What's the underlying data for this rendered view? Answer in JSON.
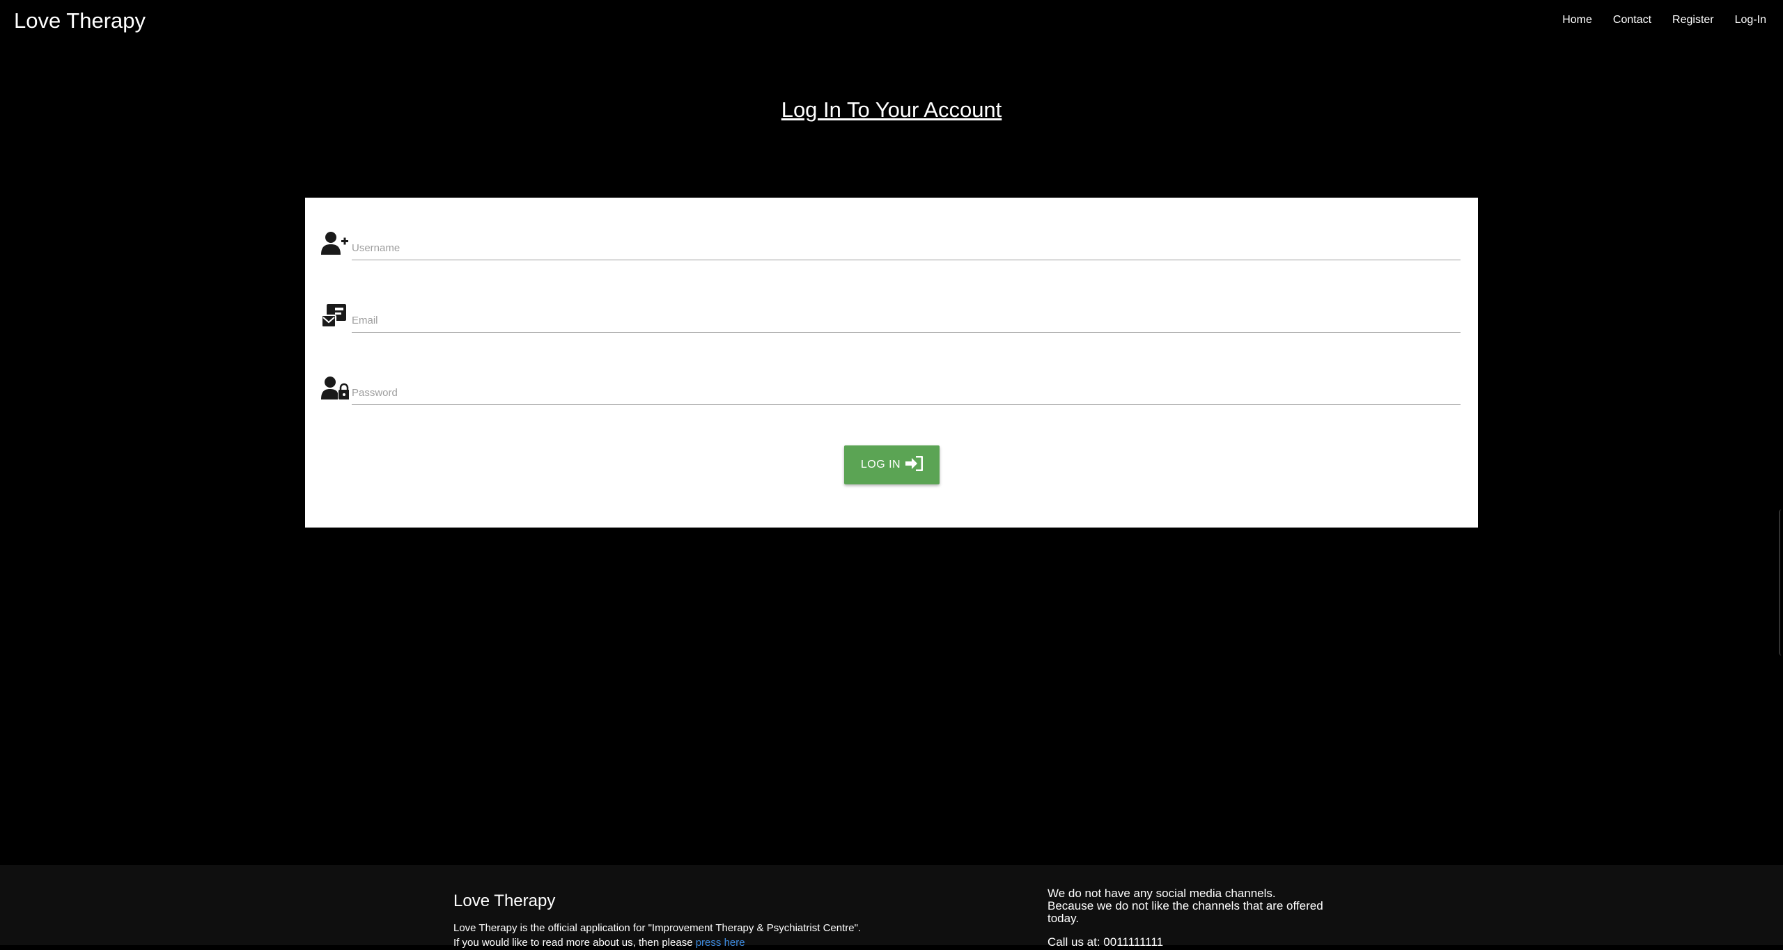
{
  "nav": {
    "brand": "Love Therapy",
    "links": [
      "Home",
      "Contact",
      "Register",
      "Log-In"
    ]
  },
  "main": {
    "title": "Log In To Your Account",
    "form": {
      "username_placeholder": "Username",
      "email_placeholder": "Email",
      "password_placeholder": "Password",
      "submit_label": "LOG IN"
    }
  },
  "footer": {
    "title": "Love Therapy",
    "description": "Love Therapy is the official application for \"Improvement Therapy & Psychiatrist Centre\".",
    "more_prefix": "If you would like to read more about us, then please ",
    "more_link": "press here",
    "social_line1": "We do not have any social media channels.",
    "social_line2": "Because we do not like the channels that are offered today.",
    "call": "Call us at: 0011111111"
  },
  "colors": {
    "background": "#000000",
    "card": "#ffffff",
    "button": "#5ba454",
    "link": "#3d8be0",
    "footer": "#0f0f0f"
  },
  "icons": [
    "user-plus-icon",
    "mail-card-icon",
    "user-lock-icon",
    "sign-in-icon"
  ]
}
